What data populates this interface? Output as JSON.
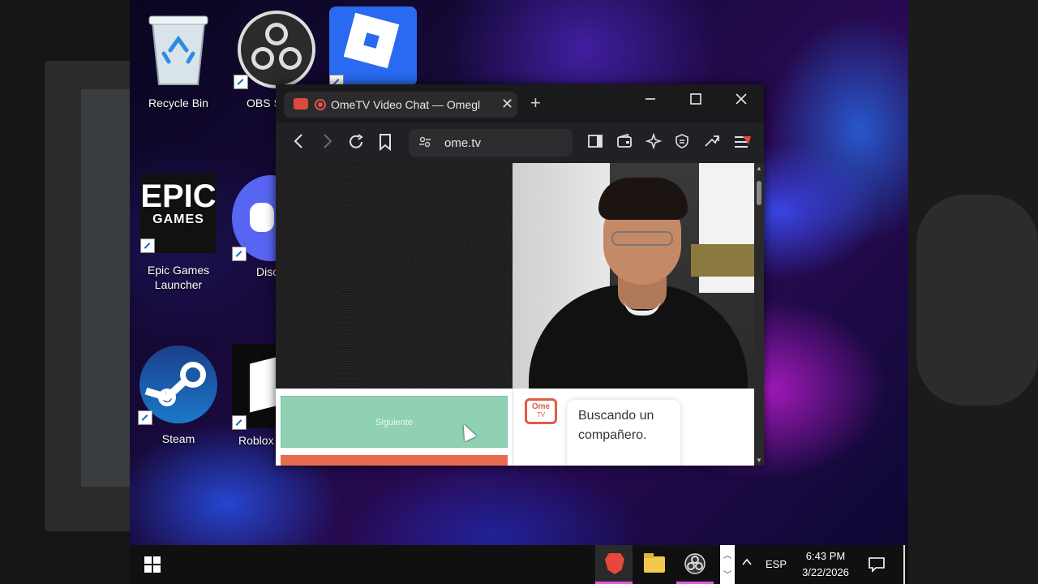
{
  "desktop": {
    "icons": [
      {
        "label": "Recycle Bin"
      },
      {
        "label": "OBS S"
      },
      {
        "label": "Epic Games Launcher",
        "logo_text_1": "EPIC",
        "logo_text_2": "GAMES"
      },
      {
        "label": "Disc"
      },
      {
        "label": "Steam"
      },
      {
        "label": "Roblox"
      }
    ]
  },
  "browser": {
    "tab_title": "OmeTV Video Chat — Omegl",
    "url": "ome.tv",
    "new_tab_glyph": "+",
    "close_tab_glyph": "✕"
  },
  "page": {
    "next_button": "Siguiente",
    "chat_message": "Buscando un compañero.",
    "logo_line1": "Ome",
    "logo_line2": "TV"
  },
  "taskbar": {
    "language": "ESP",
    "time": "6:43 PM",
    "date": "3/22/2026",
    "colors": {
      "brave": "#e8483b",
      "explorer": "#f2c94c",
      "active_underline": "#e35ae0"
    }
  }
}
